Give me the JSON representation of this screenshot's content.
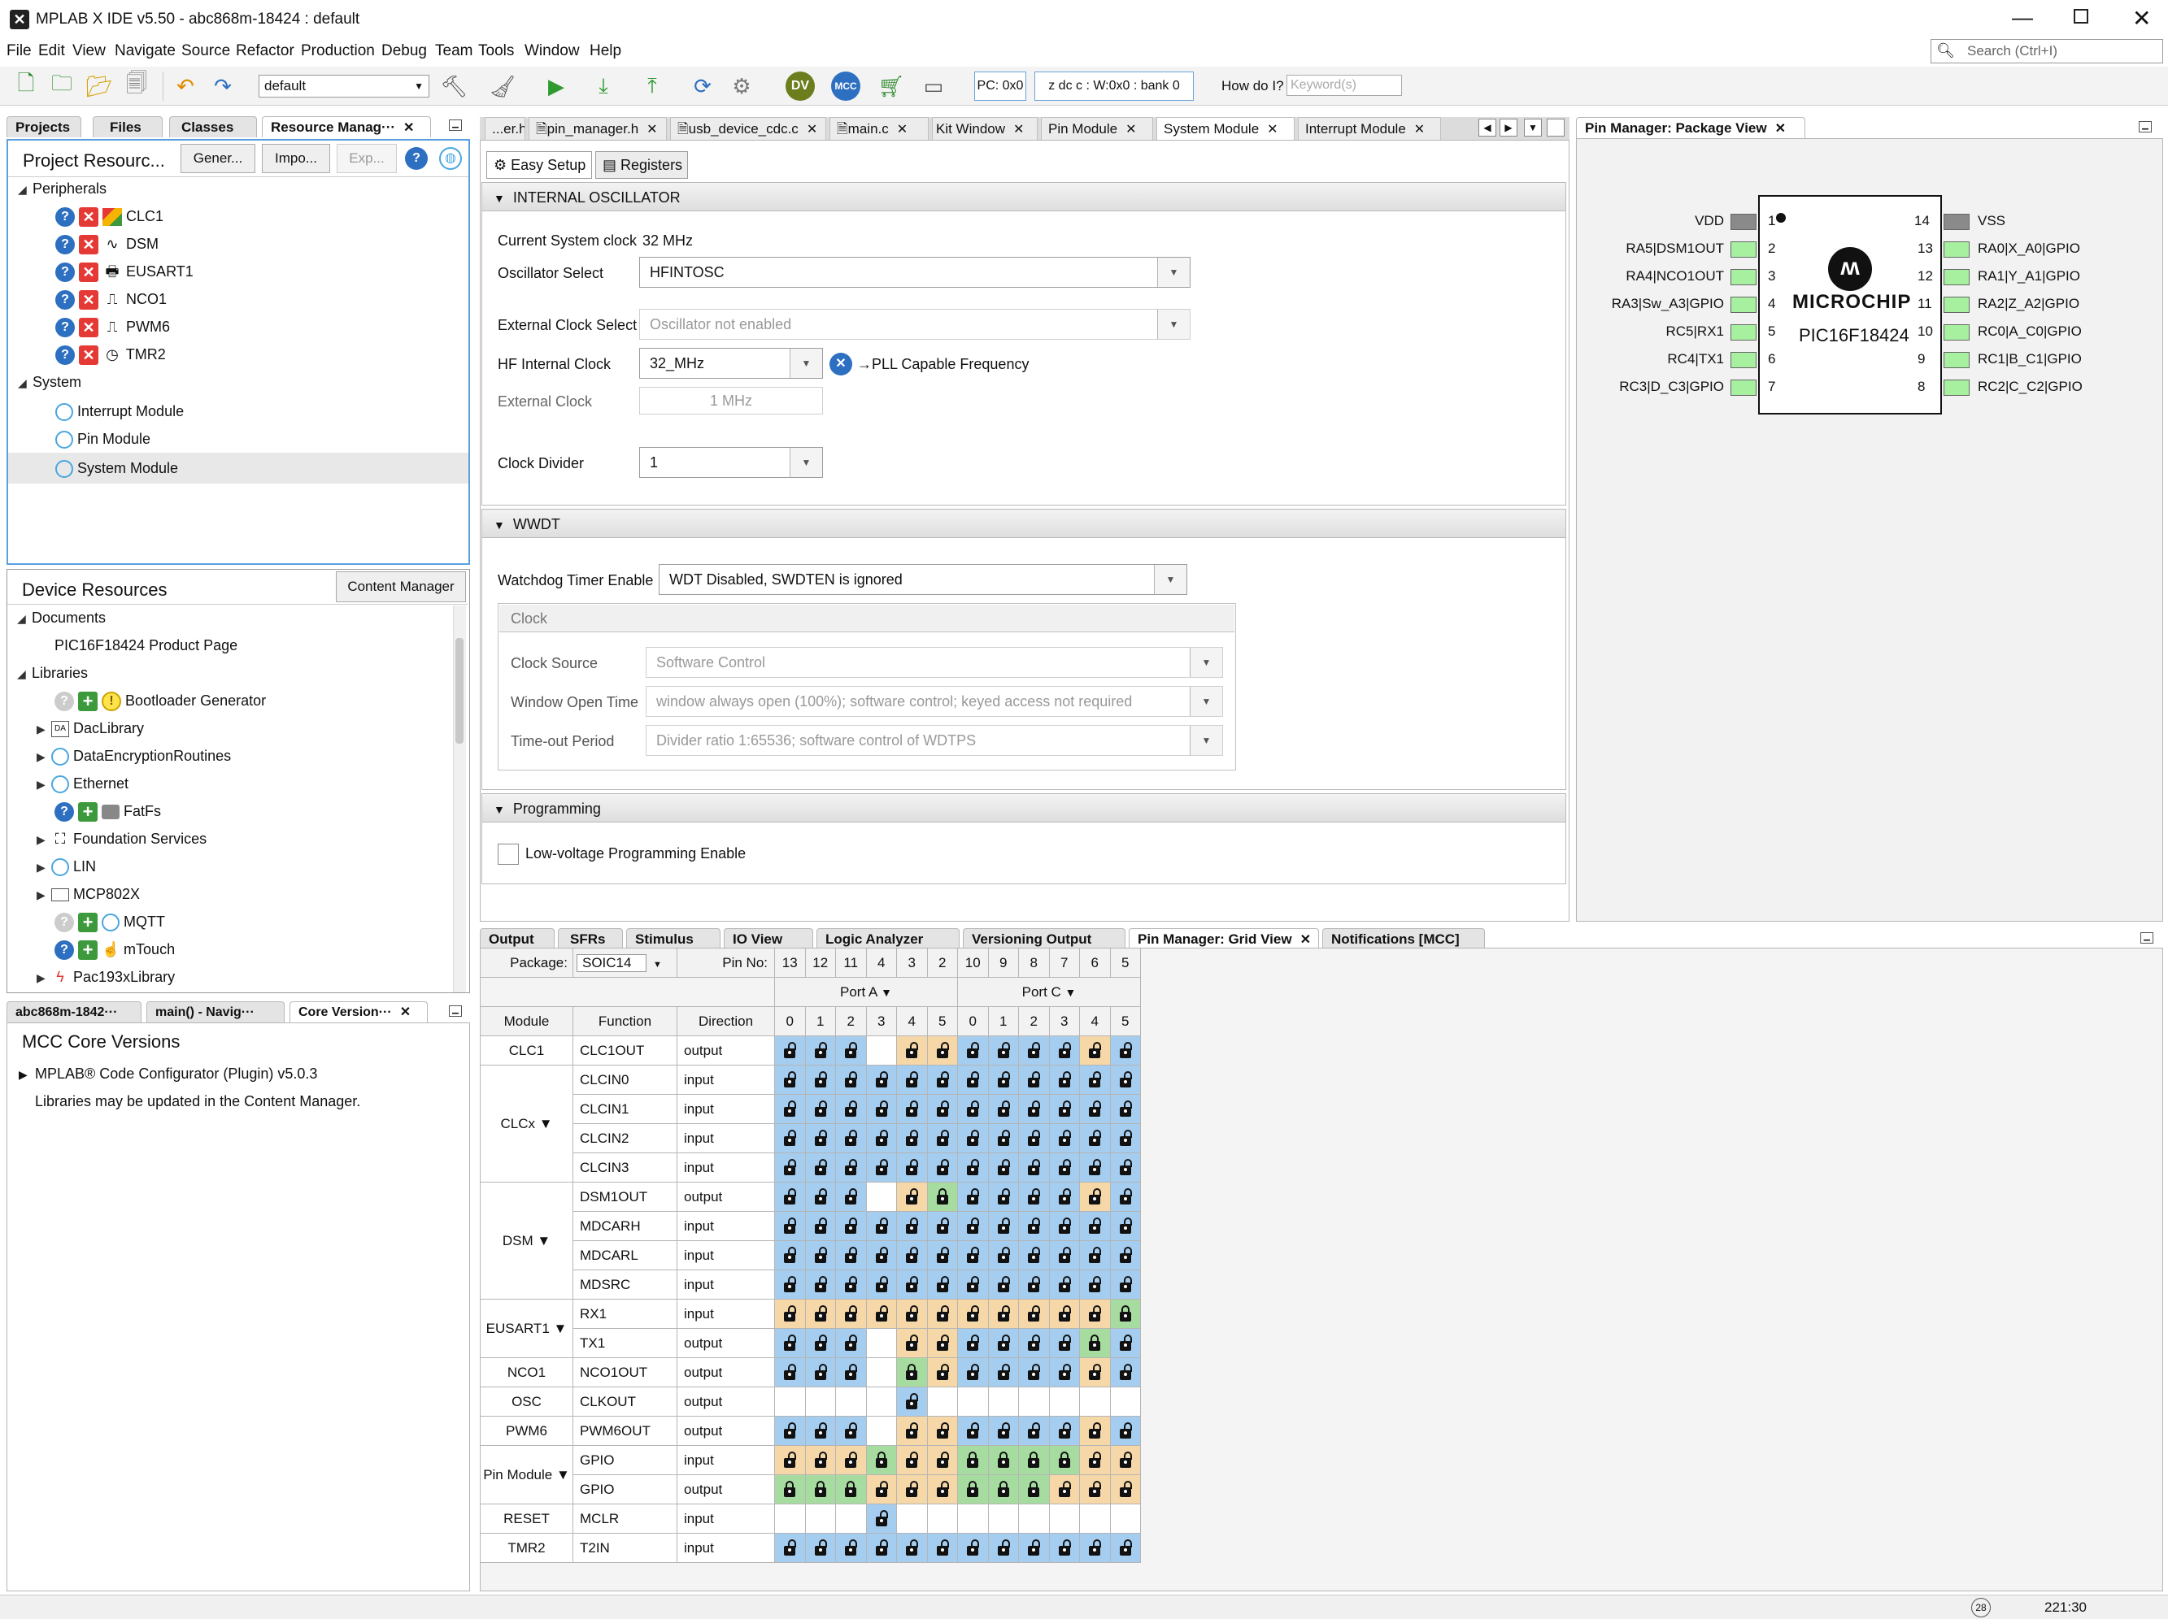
{
  "window": {
    "title": "MPLAB X IDE v5.50 - abc868m-18424 : default",
    "search_placeholder": "Search (Ctrl+I)"
  },
  "menu": [
    "File",
    "Edit",
    "View",
    "Navigate",
    "Source",
    "Refactor",
    "Production",
    "Debug",
    "Team",
    "Tools",
    "Window",
    "Help"
  ],
  "toolbar": {
    "config": "default",
    "pc": "PC: 0x0",
    "status": "z dc c  : W:0x0 : bank 0",
    "howdoi": "How do I?",
    "keyword_placeholder": "Keyword(s)"
  },
  "left_tabs": [
    "Projects",
    "Files",
    "Classes",
    "Resource Manag···"
  ],
  "project_resources": {
    "title": "Project Resourc...",
    "btn_generate": "Gener...",
    "btn_import": "Impo...",
    "btn_export": "Exp...",
    "peripherals_label": "Peripherals",
    "peripherals": [
      "CLC1",
      "DSM",
      "EUSART1",
      "NCO1",
      "PWM6",
      "TMR2"
    ],
    "system_label": "System",
    "system": [
      "Interrupt Module",
      "Pin Module",
      "System Module"
    ]
  },
  "device_resources": {
    "title": "Device Resources",
    "content_manager": "Content Manager",
    "documents_label": "Documents",
    "product_page": "PIC16F18424 Product Page",
    "libraries_label": "Libraries",
    "libraries": [
      "Bootloader Generator",
      "DacLibrary",
      "DataEncryptionRoutines",
      "Ethernet",
      "FatFs",
      "Foundation Services",
      "LIN",
      "MCP802X",
      "MQTT",
      "mTouch",
      "Pac193xLibrary"
    ]
  },
  "bottom_left_tabs": [
    "abc868m-1842···",
    "main() - Navig···",
    "Core Version···"
  ],
  "core_versions": {
    "title": "MCC Core Versions",
    "plugin": "MPLAB® Code Configurator (Plugin) v5.0.3",
    "note": "Libraries may be updated in the Content Manager."
  },
  "editor_tabs": [
    "...er.h",
    "pin_manager.h",
    "usb_device_cdc.c",
    "main.c",
    "Kit Window",
    "Pin Module",
    "System Module",
    "Interrupt Module"
  ],
  "setup_tabs": {
    "easy": "Easy Setup",
    "registers": "Registers"
  },
  "osc": {
    "header": "INTERNAL OSCILLATOR",
    "current_clock_label": "Current System clock",
    "current_clock_value": "32 MHz",
    "osc_select_label": "Oscillator Select",
    "osc_select_value": "HFINTOSC",
    "ext_clock_select_label": "External Clock Select",
    "ext_clock_select_value": "Oscillator not enabled",
    "hf_clock_label": "HF Internal Clock",
    "hf_clock_value": "32_MHz",
    "pll_note": "→PLL Capable Frequency",
    "ext_clock_label": "External Clock",
    "ext_clock_value": "1 MHz",
    "divider_label": "Clock Divider",
    "divider_value": "1"
  },
  "wwdt": {
    "header": "WWDT",
    "enable_label": "Watchdog Timer Enable",
    "enable_value": "WDT Disabled, SWDTEN is ignored",
    "clock_group": "Clock",
    "source_label": "Clock Source",
    "source_value": "Software Control",
    "window_label": "Window Open Time",
    "window_value": "window always open (100%); software control; keyed access not required",
    "timeout_label": "Time-out Period",
    "timeout_value": "Divider ratio 1:65536; software control of WDTPS"
  },
  "programming": {
    "header": "Programming",
    "lvp_label": "Low-voltage Programming Enable"
  },
  "package_view": {
    "tab": "Pin Manager: Package View",
    "chip_name": "PIC16F18424",
    "brand": "MICROCHIP",
    "left_pins": [
      {
        "n": "1",
        "label": "VDD"
      },
      {
        "n": "2",
        "label": "RA5|DSM1OUT"
      },
      {
        "n": "3",
        "label": "RA4|NCO1OUT"
      },
      {
        "n": "4",
        "label": "RA3|Sw_A3|GPIO"
      },
      {
        "n": "5",
        "label": "RC5|RX1"
      },
      {
        "n": "6",
        "label": "RC4|TX1"
      },
      {
        "n": "7",
        "label": "RC3|D_C3|GPIO"
      }
    ],
    "right_pins": [
      {
        "n": "14",
        "label": "VSS"
      },
      {
        "n": "13",
        "label": "RA0|X_A0|GPIO"
      },
      {
        "n": "12",
        "label": "RA1|Y_A1|GPIO"
      },
      {
        "n": "11",
        "label": "RA2|Z_A2|GPIO"
      },
      {
        "n": "10",
        "label": "RC0|A_C0|GPIO"
      },
      {
        "n": "9",
        "label": "RC1|B_C1|GPIO"
      },
      {
        "n": "8",
        "label": "RC2|C_C2|GPIO"
      }
    ]
  },
  "output_tabs": [
    "Output",
    "SFRs",
    "Stimulus",
    "IO View",
    "Logic Analyzer",
    "Versioning Output",
    "Pin Manager: Grid View",
    "Notifications [MCC]"
  ],
  "grid": {
    "package_label": "Package:",
    "package_value": "SOIC14",
    "pinno_label": "Pin No:",
    "pin_numbers": [
      "13",
      "12",
      "11",
      "4",
      "3",
      "2",
      "10",
      "9",
      "8",
      "7",
      "6",
      "5"
    ],
    "port_a": "Port A",
    "port_c": "Port C",
    "bits": [
      "0",
      "1",
      "2",
      "3",
      "4",
      "5",
      "0",
      "1",
      "2",
      "3",
      "4",
      "5"
    ],
    "col_module": "Module",
    "col_function": "Function",
    "col_direction": "Direction",
    "rows": [
      {
        "module": "CLC1",
        "span": 1,
        "function": "CLC1OUT",
        "direction": "output",
        "cells": "bbbeoobbbbob"
      },
      {
        "module": "CLCx ▼",
        "span": 4,
        "function": "CLCIN0",
        "direction": "input",
        "cells": "bbbbbbbbbbbb"
      },
      {
        "function": "CLCIN1",
        "direction": "input",
        "cells": "bbbbbbbbbbbb"
      },
      {
        "function": "CLCIN2",
        "direction": "input",
        "cells": "bbbbbbbbbbbb"
      },
      {
        "function": "CLCIN3",
        "direction": "input",
        "cells": "bbbbbbbbbbbb"
      },
      {
        "module": "DSM ▼",
        "span": 4,
        "function": "DSM1OUT",
        "direction": "output",
        "cells": "bbbeoGbbbbob"
      },
      {
        "function": "MDCARH",
        "direction": "input",
        "cells": "bbbbbbbbbbbb"
      },
      {
        "function": "MDCARL",
        "direction": "input",
        "cells": "bbbbbbbbbbbb"
      },
      {
        "function": "MDSRC",
        "direction": "input",
        "cells": "bbbbbbbbbbbb"
      },
      {
        "module": "EUSART1 ▼",
        "span": 2,
        "function": "RX1",
        "direction": "input",
        "cells": "oooooooooooG"
      },
      {
        "function": "TX1",
        "direction": "output",
        "cells": "bbbeoobbbbGb"
      },
      {
        "module": "NCO1",
        "span": 1,
        "function": "NCO1OUT",
        "direction": "output",
        "cells": "bbbeGobbbbob"
      },
      {
        "module": "OSC",
        "span": 1,
        "function": "CLKOUT",
        "direction": "output",
        "cells": "eeeebeeeeeee"
      },
      {
        "module": "PWM6",
        "span": 1,
        "function": "PWM6OUT",
        "direction": "output",
        "cells": "bbbeoobbbbob"
      },
      {
        "module": "Pin Module ▼",
        "span": 2,
        "function": "GPIO",
        "direction": "input",
        "cells": "oooGooGGGGoo"
      },
      {
        "function": "GPIO",
        "direction": "output",
        "cells": "GGGoooGGGooo"
      },
      {
        "module": "RESET",
        "span": 1,
        "function": "MCLR",
        "direction": "input",
        "cells": "eeebeeeeeeee"
      },
      {
        "module": "TMR2",
        "span": 1,
        "function": "T2IN",
        "direction": "input",
        "cells": "bbbbbbbbbbbb"
      }
    ]
  },
  "status": {
    "badge": "28",
    "time": "221:30"
  }
}
